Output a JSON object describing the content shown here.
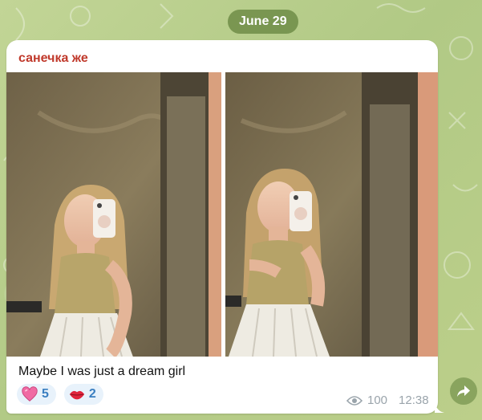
{
  "date_divider": "June 29",
  "message": {
    "sender": "санечка же",
    "caption": "Maybe I was just a dream girl",
    "reactions": [
      {
        "emoji": "pink-heart-icon",
        "count": "5"
      },
      {
        "emoji": "kiss-lips-icon",
        "count": "2"
      }
    ],
    "views": "100",
    "time": "12:38"
  },
  "colors": {
    "sender_name": "#c0392b",
    "reaction_count": "#3a7fc1",
    "wallpaper": "#b9cf8e"
  }
}
